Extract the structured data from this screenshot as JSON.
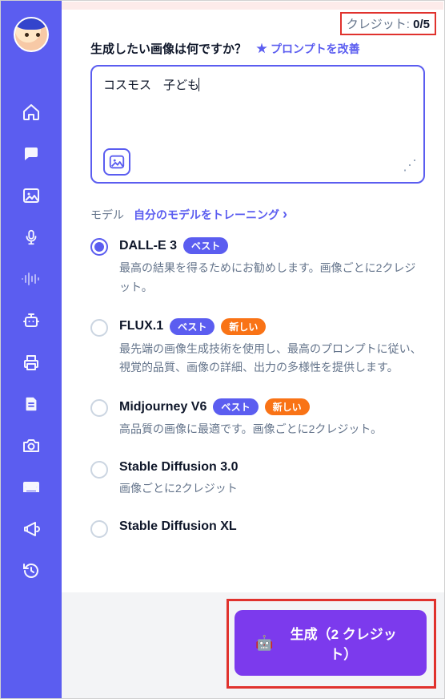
{
  "credits": {
    "label": "クレジット: ",
    "used": "0",
    "sep": "/",
    "total": "5"
  },
  "prompt": {
    "label": "生成したい画像は何ですか？",
    "improve": "プロンプトを改善",
    "value": "コスモス　子ども"
  },
  "models_section": {
    "title": "モデル",
    "train_link": "自分のモデルをトレーニング"
  },
  "pills": {
    "best": "ベスト",
    "new": "新しい"
  },
  "models": [
    {
      "name": "DALL-E 3",
      "best": true,
      "new": false,
      "selected": true,
      "desc": "最高の結果を得るためにお勧めします。画像ごとに2クレジット。"
    },
    {
      "name": "FLUX.1",
      "best": true,
      "new": true,
      "selected": false,
      "desc": "最先端の画像生成技術を使用し、最高のプロンプトに従い、視覚的品質、画像の詳細、出力の多様性を提供します。"
    },
    {
      "name": "Midjourney V6",
      "best": true,
      "new": true,
      "selected": false,
      "desc": "高品質の画像に最適です。画像ごとに2クレジット。"
    },
    {
      "name": "Stable Diffusion 3.0",
      "best": false,
      "new": false,
      "selected": false,
      "desc": "画像ごとに2クレジット"
    },
    {
      "name": "Stable Diffusion XL",
      "best": false,
      "new": false,
      "selected": false,
      "desc": ""
    }
  ],
  "generate": {
    "label": "生成（2 クレジット）",
    "robot": "🤖"
  },
  "sidebar_icons": [
    "home-icon",
    "chat-icon",
    "image-icon",
    "mic-icon",
    "audio-wave-icon",
    "robot-icon",
    "print-icon",
    "document-icon",
    "camera-icon",
    "sofa-icon",
    "megaphone-icon",
    "history-icon"
  ]
}
